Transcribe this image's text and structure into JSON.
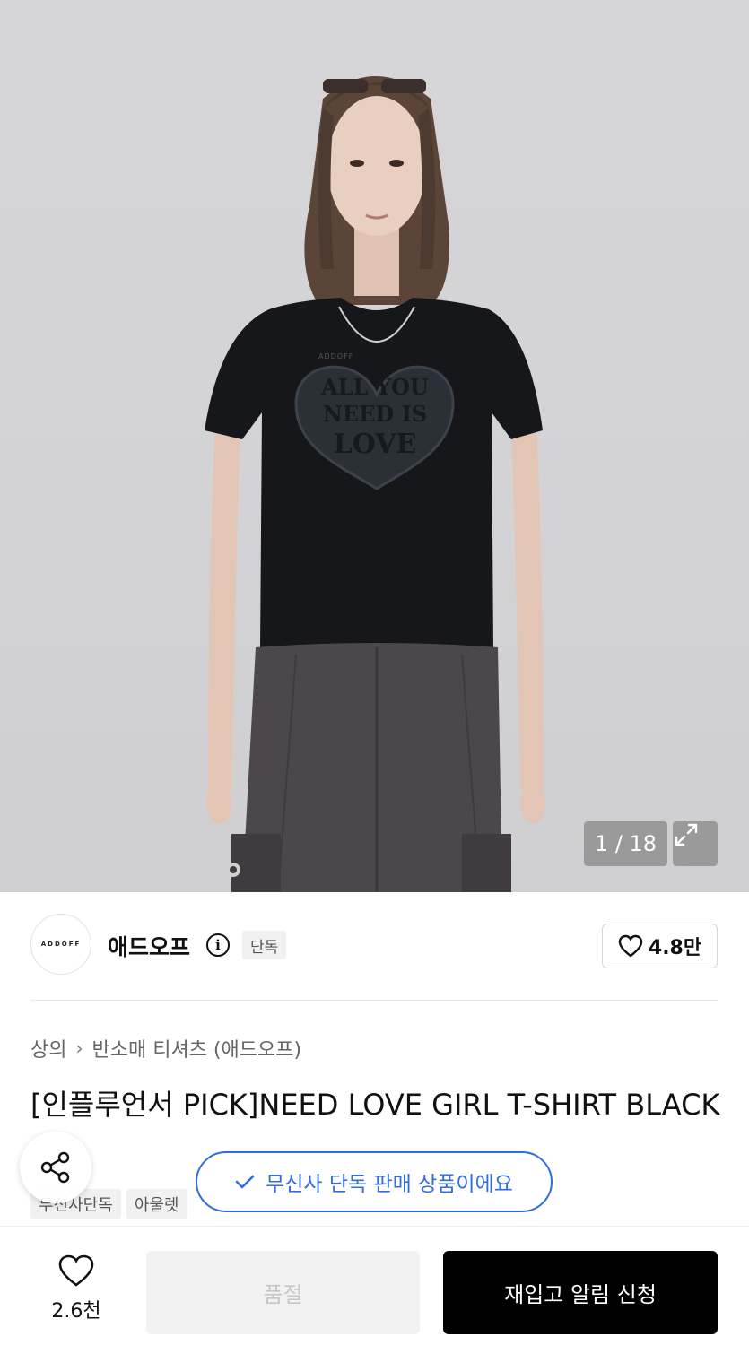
{
  "gallery": {
    "current": "1 / 18",
    "shirt_print": [
      "ALL YOU",
      "NEED IS",
      "LOVE"
    ],
    "shirt_brand": "ADDOFF"
  },
  "brand": {
    "logo_text": "ADDOFF",
    "name": "애드오프",
    "badge": "단독",
    "likes": "4.8만"
  },
  "breadcrumb": {
    "category": "상의",
    "subcategory": "반소매 티셔츠 (애드오프)"
  },
  "product": {
    "title": "[인플루언서 PICK]NEED LOVE GIRL T-SHIRT BLACK",
    "tags": [
      "무신사단독",
      "아울렛"
    ]
  },
  "toast": {
    "text": "무신사 단독 판매 상품이에요"
  },
  "bottom_bar": {
    "wish_count": "2.6천",
    "soldout_label": "품절",
    "restock_label": "재입고 알림 신청"
  },
  "colors": {
    "accent_blue": "#2f6de0",
    "primary_black": "#000000",
    "disabled_bg": "#f2f2f2"
  },
  "icons": [
    "info-icon",
    "heart-icon",
    "expand-icon",
    "share-icon",
    "check-icon",
    "chevron-right-icon"
  ]
}
